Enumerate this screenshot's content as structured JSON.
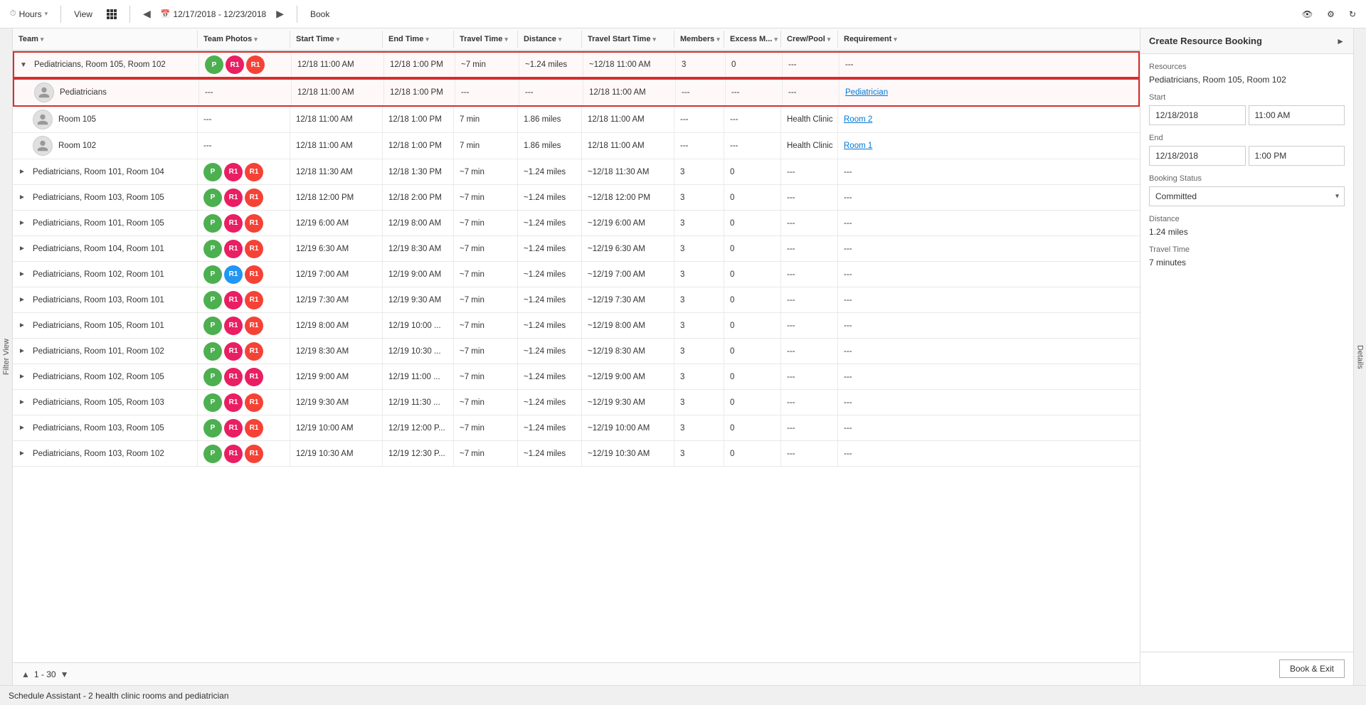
{
  "toolbar": {
    "hours_label": "Hours",
    "view_label": "View",
    "date_range": "12/17/2018 - 12/23/2018",
    "book_label": "Book"
  },
  "columns": [
    {
      "id": "team",
      "label": "Team"
    },
    {
      "id": "teamPhotos",
      "label": "Team Photos"
    },
    {
      "id": "startTime",
      "label": "Start Time"
    },
    {
      "id": "endTime",
      "label": "End Time"
    },
    {
      "id": "travelTime",
      "label": "Travel Time"
    },
    {
      "id": "distance",
      "label": "Distance"
    },
    {
      "id": "travelStartTime",
      "label": "Travel Start Time"
    },
    {
      "id": "members",
      "label": "Members"
    },
    {
      "id": "excessM",
      "label": "Excess M..."
    },
    {
      "id": "crewPool",
      "label": "Crew/Pool"
    },
    {
      "id": "requirement",
      "label": "Requirement"
    }
  ],
  "rows": [
    {
      "id": "row1",
      "team": "Pediatricians, Room 105, Room 102",
      "expanded": true,
      "selected": true,
      "avatars": [
        {
          "letter": "P",
          "color": "#4caf50"
        },
        {
          "letter": "R1",
          "color": "#e91e63"
        },
        {
          "letter": "R1",
          "color": "#f44336"
        }
      ],
      "startTime": "12/18 11:00 AM",
      "endTime": "12/18 1:00 PM",
      "travelTime": "~7 min",
      "distance": "~1.24 miles",
      "travelStartTime": "~12/18 11:00 AM",
      "members": "3",
      "excessM": "0",
      "crewPool": "---",
      "requirement": "---",
      "children": [
        {
          "id": "child1",
          "team": "Pediatricians",
          "selected": true,
          "hasAvatar": true,
          "startTime": "12/18 11:00 AM",
          "endTime": "12/18 1:00 PM",
          "travelTime": "---",
          "distance": "---",
          "travelStartTime": "12/18 11:00 AM",
          "members": "---",
          "excessM": "---",
          "crewPool": "---",
          "requirement": "Pediatrician",
          "requirementLink": true
        },
        {
          "id": "child2",
          "team": "Room 105",
          "hasAvatar": true,
          "startTime": "12/18 11:00 AM",
          "endTime": "12/18 1:00 PM",
          "travelTime": "7 min",
          "distance": "1.86 miles",
          "travelStartTime": "12/18 11:00 AM",
          "members": "---",
          "excessM": "---",
          "crewPool": "Health Clinic",
          "requirement": "Room 2",
          "requirementLink": true
        },
        {
          "id": "child3",
          "team": "Room 102",
          "hasAvatar": true,
          "startTime": "12/18 11:00 AM",
          "endTime": "12/18 1:00 PM",
          "travelTime": "7 min",
          "distance": "1.86 miles",
          "travelStartTime": "12/18 11:00 AM",
          "members": "---",
          "excessM": "---",
          "crewPool": "Health Clinic",
          "requirement": "Room 1",
          "requirementLink": true
        }
      ]
    },
    {
      "id": "row2",
      "team": "Pediatricians, Room 101, Room 104",
      "expanded": false,
      "avatars": [
        {
          "letter": "P",
          "color": "#4caf50"
        },
        {
          "letter": "R1",
          "color": "#e91e63"
        },
        {
          "letter": "R1",
          "color": "#f44336"
        }
      ],
      "startTime": "12/18 11:30 AM",
      "endTime": "12/18 1:30 PM",
      "travelTime": "~7 min",
      "distance": "~1.24 miles",
      "travelStartTime": "~12/18 11:30 AM",
      "members": "3",
      "excessM": "0",
      "crewPool": "---",
      "requirement": "---"
    },
    {
      "id": "row3",
      "team": "Pediatricians, Room 103, Room 105",
      "expanded": false,
      "avatars": [
        {
          "letter": "P",
          "color": "#4caf50"
        },
        {
          "letter": "R1",
          "color": "#e91e63"
        },
        {
          "letter": "R1",
          "color": "#f44336"
        }
      ],
      "startTime": "12/18 12:00 PM",
      "endTime": "12/18 2:00 PM",
      "travelTime": "~7 min",
      "distance": "~1.24 miles",
      "travelStartTime": "~12/18 12:00 PM",
      "members": "3",
      "excessM": "0",
      "crewPool": "---",
      "requirement": "---"
    },
    {
      "id": "row4",
      "team": "Pediatricians, Room 101, Room 105",
      "expanded": false,
      "avatars": [
        {
          "letter": "P",
          "color": "#4caf50"
        },
        {
          "letter": "R1",
          "color": "#e91e63"
        },
        {
          "letter": "R1",
          "color": "#f44336"
        }
      ],
      "startTime": "12/19 6:00 AM",
      "endTime": "12/19 8:00 AM",
      "travelTime": "~7 min",
      "distance": "~1.24 miles",
      "travelStartTime": "~12/19 6:00 AM",
      "members": "3",
      "excessM": "0",
      "crewPool": "---",
      "requirement": "---"
    },
    {
      "id": "row5",
      "team": "Pediatricians, Room 104, Room 101",
      "expanded": false,
      "avatars": [
        {
          "letter": "P",
          "color": "#4caf50"
        },
        {
          "letter": "R1",
          "color": "#e91e63"
        },
        {
          "letter": "R1",
          "color": "#f44336"
        }
      ],
      "startTime": "12/19 6:30 AM",
      "endTime": "12/19 8:30 AM",
      "travelTime": "~7 min",
      "distance": "~1.24 miles",
      "travelStartTime": "~12/19 6:30 AM",
      "members": "3",
      "excessM": "0",
      "crewPool": "---",
      "requirement": "---"
    },
    {
      "id": "row6",
      "team": "Pediatricians, Room 102, Room 101",
      "expanded": false,
      "avatars": [
        {
          "letter": "P",
          "color": "#4caf50"
        },
        {
          "letter": "R1",
          "color": "#2196f3"
        },
        {
          "letter": "R1",
          "color": "#f44336"
        }
      ],
      "startTime": "12/19 7:00 AM",
      "endTime": "12/19 9:00 AM",
      "travelTime": "~7 min",
      "distance": "~1.24 miles",
      "travelStartTime": "~12/19 7:00 AM",
      "members": "3",
      "excessM": "0",
      "crewPool": "---",
      "requirement": "---"
    },
    {
      "id": "row7",
      "team": "Pediatricians, Room 103, Room 101",
      "expanded": false,
      "avatars": [
        {
          "letter": "P",
          "color": "#4caf50"
        },
        {
          "letter": "R1",
          "color": "#e91e63"
        },
        {
          "letter": "R1",
          "color": "#f44336"
        }
      ],
      "startTime": "12/19 7:30 AM",
      "endTime": "12/19 9:30 AM",
      "travelTime": "~7 min",
      "distance": "~1.24 miles",
      "travelStartTime": "~12/19 7:30 AM",
      "members": "3",
      "excessM": "0",
      "crewPool": "---",
      "requirement": "---"
    },
    {
      "id": "row8",
      "team": "Pediatricians, Room 105, Room 101",
      "expanded": false,
      "avatars": [
        {
          "letter": "P",
          "color": "#4caf50"
        },
        {
          "letter": "R1",
          "color": "#e91e63"
        },
        {
          "letter": "R1",
          "color": "#f44336"
        }
      ],
      "startTime": "12/19 8:00 AM",
      "endTime": "12/19 10:00 ...",
      "travelTime": "~7 min",
      "distance": "~1.24 miles",
      "travelStartTime": "~12/19 8:00 AM",
      "members": "3",
      "excessM": "0",
      "crewPool": "---",
      "requirement": "---"
    },
    {
      "id": "row9",
      "team": "Pediatricians, Room 101, Room 102",
      "expanded": false,
      "avatars": [
        {
          "letter": "P",
          "color": "#4caf50"
        },
        {
          "letter": "R1",
          "color": "#e91e63"
        },
        {
          "letter": "R1",
          "color": "#f44336"
        }
      ],
      "startTime": "12/19 8:30 AM",
      "endTime": "12/19 10:30 ...",
      "travelTime": "~7 min",
      "distance": "~1.24 miles",
      "travelStartTime": "~12/19 8:30 AM",
      "members": "3",
      "excessM": "0",
      "crewPool": "---",
      "requirement": "---"
    },
    {
      "id": "row10",
      "team": "Pediatricians, Room 102, Room 105",
      "expanded": false,
      "avatars": [
        {
          "letter": "P",
          "color": "#4caf50"
        },
        {
          "letter": "R1",
          "color": "#e91e63"
        },
        {
          "letter": "R1",
          "color": "#e91e63"
        }
      ],
      "startTime": "12/19 9:00 AM",
      "endTime": "12/19 11:00 ...",
      "travelTime": "~7 min",
      "distance": "~1.24 miles",
      "travelStartTime": "~12/19 9:00 AM",
      "members": "3",
      "excessM": "0",
      "crewPool": "---",
      "requirement": "---"
    },
    {
      "id": "row11",
      "team": "Pediatricians, Room 105, Room 103",
      "expanded": false,
      "avatars": [
        {
          "letter": "P",
          "color": "#4caf50"
        },
        {
          "letter": "R1",
          "color": "#e91e63"
        },
        {
          "letter": "R1",
          "color": "#f44336"
        }
      ],
      "startTime": "12/19 9:30 AM",
      "endTime": "12/19 11:30 ...",
      "travelTime": "~7 min",
      "distance": "~1.24 miles",
      "travelStartTime": "~12/19 9:30 AM",
      "members": "3",
      "excessM": "0",
      "crewPool": "---",
      "requirement": "---"
    },
    {
      "id": "row12",
      "team": "Pediatricians, Room 103, Room 105",
      "expanded": false,
      "avatars": [
        {
          "letter": "P",
          "color": "#4caf50"
        },
        {
          "letter": "R1",
          "color": "#e91e63"
        },
        {
          "letter": "R1",
          "color": "#f44336"
        }
      ],
      "startTime": "12/19 10:00 AM",
      "endTime": "12/19 12:00 P...",
      "travelTime": "~7 min",
      "distance": "~1.24 miles",
      "travelStartTime": "~12/19 10:00 AM",
      "members": "3",
      "excessM": "0",
      "crewPool": "---",
      "requirement": "---"
    },
    {
      "id": "row13",
      "team": "Pediatricians, Room 103, Room 102",
      "expanded": false,
      "avatars": [
        {
          "letter": "P",
          "color": "#4caf50"
        },
        {
          "letter": "R1",
          "color": "#e91e63"
        },
        {
          "letter": "R1",
          "color": "#f44336"
        }
      ],
      "startTime": "12/19 10:30 AM",
      "endTime": "12/19 12:30 P...",
      "travelTime": "~7 min",
      "distance": "~1.24 miles",
      "travelStartTime": "~12/19 10:30 AM",
      "members": "3",
      "excessM": "0",
      "crewPool": "---",
      "requirement": "---"
    }
  ],
  "pagination": {
    "current": "1 - 30",
    "up_btn": "▲",
    "down_btn": "▼"
  },
  "status_bar": {
    "text": "Schedule Assistant - 2 health clinic rooms and pediatrician"
  },
  "right_panel": {
    "title": "Create Resource Booking",
    "resources_label": "Resources",
    "resources_value": "Pediatricians, Room 105, Room 102",
    "start_label": "Start",
    "start_date": "12/18/2018",
    "start_time": "11:00 AM",
    "end_label": "End",
    "end_date": "12/18/2018",
    "end_time": "1:00 PM",
    "booking_status_label": "Booking Status",
    "booking_status_value": "Committed",
    "distance_label": "Distance",
    "distance_value": "1.24 miles",
    "travel_time_label": "Travel Time",
    "travel_time_value": "7 minutes",
    "book_exit_label": "Book & Exit"
  }
}
